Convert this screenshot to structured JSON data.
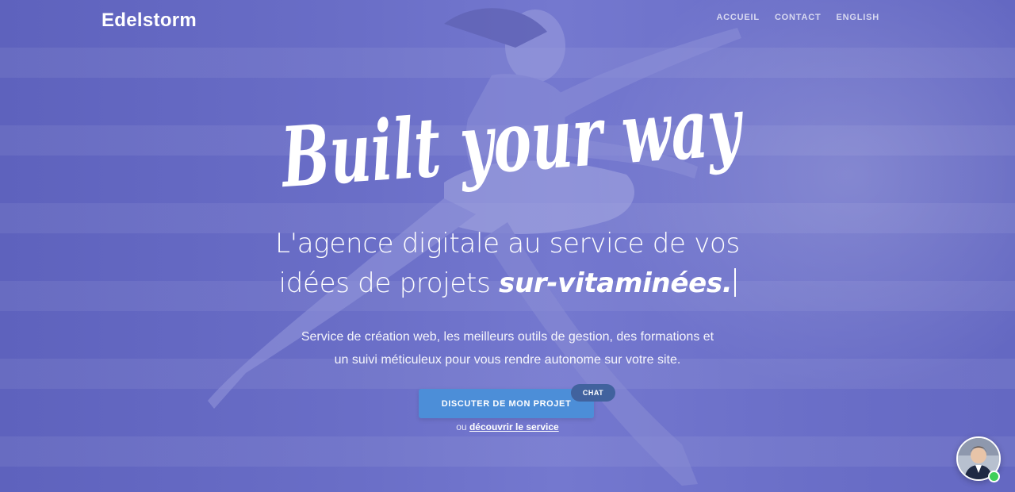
{
  "header": {
    "logo": "Edelstorm",
    "nav": [
      "ACCUEIL",
      "CONTACT",
      "ENGLISH"
    ]
  },
  "hero": {
    "script_title": "Built your way",
    "headline_line1": "L'agence digitale au service de vos",
    "headline_line2_prefix": "idées de projets ",
    "headline_emphasis": "sur-vitaminées.",
    "subtext_line1": "Service de création web, les meilleurs outils de gestion, des formations et",
    "subtext_line2": "un suivi méticuleux pour vous rendre autonome sur votre site.",
    "cta_label": "DISCUTER DE MON PROJET",
    "cta_badge": "CHAT",
    "alt_prefix": "ou ",
    "alt_link": "découvrir le service"
  },
  "chat": {
    "avatar_icon": "user-avatar-icon",
    "status_color": "#3fcf5a"
  },
  "colors": {
    "background": "#6b6fc8",
    "cta": "#4c8ed8",
    "badge": "#41629e"
  }
}
